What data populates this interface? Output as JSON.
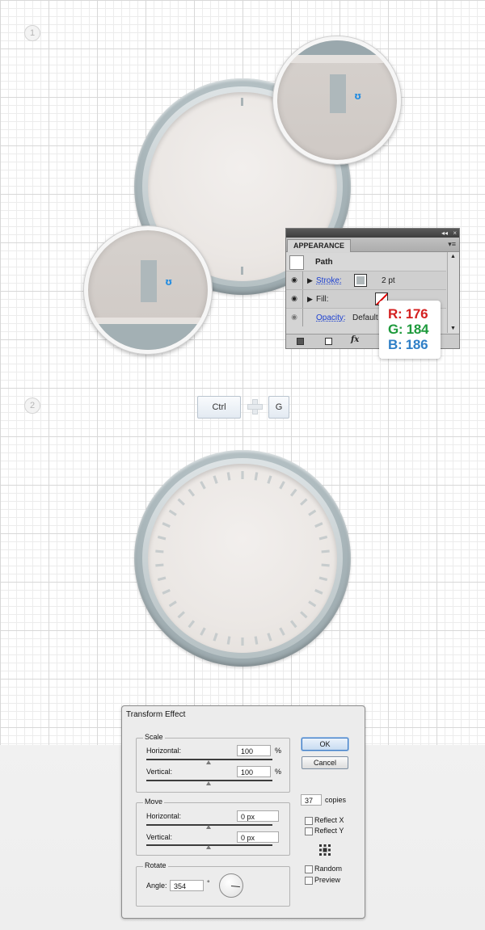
{
  "steps": {
    "step1": "1",
    "step2": "2"
  },
  "appearance_panel": {
    "title_arrows": "◂◂",
    "close": "×",
    "tab_label": "APPEARANCE",
    "menu_icon": "▾≡",
    "object_label": "Path",
    "rows": [
      {
        "label": "Stroke:",
        "value": "2 pt"
      },
      {
        "label": "Fill:",
        "value": ""
      },
      {
        "label": "Opacity:",
        "value": "Default"
      }
    ]
  },
  "rgb_readout": {
    "r": "R: 176",
    "g": "G: 184",
    "b": "B: 186"
  },
  "shortcut": {
    "key1": "Ctrl",
    "key2": "G"
  },
  "colors": {
    "r": "#d42020",
    "g": "#1e9a3c",
    "b": "#2f7fc7",
    "bezel": "#b0b8ba"
  },
  "transform_dialog": {
    "title": "Transform Effect",
    "scale": {
      "label": "Scale",
      "horizontal_label": "Horizontal:",
      "horizontal_value": "100",
      "horizontal_unit": "%",
      "vertical_label": "Vertical:",
      "vertical_value": "100",
      "vertical_unit": "%"
    },
    "move": {
      "label": "Move",
      "horizontal_label": "Horizontal:",
      "horizontal_value": "0 px",
      "vertical_label": "Vertical:",
      "vertical_value": "0 px"
    },
    "rotate": {
      "label": "Rotate",
      "angle_label": "Angle:",
      "angle_value": "354",
      "degree": "°"
    },
    "ok": "OK",
    "cancel": "Cancel",
    "copies_value": "37",
    "copies_label": "copies",
    "reflect_x": "Reflect X",
    "reflect_y": "Reflect Y",
    "random": "Random",
    "preview": "Preview"
  }
}
